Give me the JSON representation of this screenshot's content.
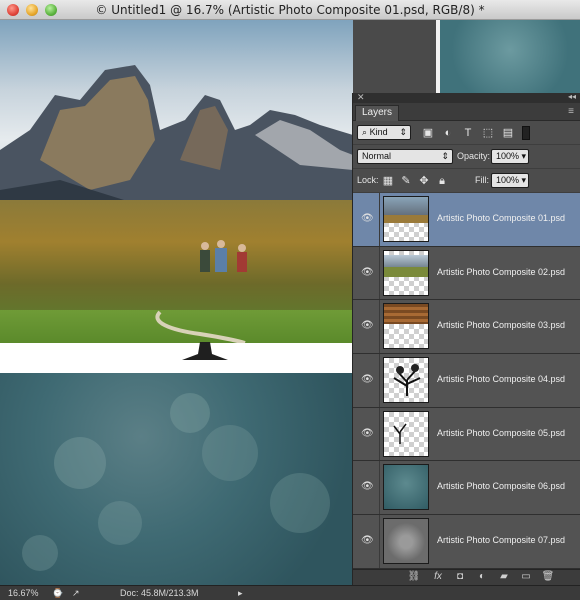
{
  "window": {
    "title": "© Untitled1 @ 16.7% (Artistic Photo Composite 01.psd, RGB/8) *"
  },
  "status": {
    "zoom": "16.67%",
    "doc": "Doc: 45.8M/213.3M"
  },
  "layers_panel": {
    "tab_label": "Layers",
    "filter_label": "Kind",
    "blend_mode": "Normal",
    "opacity_label": "Opacity:",
    "opacity_value": "100%",
    "lock_label": "Lock:",
    "fill_label": "Fill:",
    "fill_value": "100%",
    "layers": [
      {
        "name": "Artistic Photo Composite 01.psd",
        "selected": true,
        "thumb": "mountains"
      },
      {
        "name": "Artistic Photo Composite 02.psd",
        "selected": false,
        "thumb": "landscape"
      },
      {
        "name": "Artistic Photo Composite 03.psd",
        "selected": false,
        "thumb": "wood"
      },
      {
        "name": "Artistic Photo Composite 04.psd",
        "selected": false,
        "thumb": "tree"
      },
      {
        "name": "Artistic Photo Composite 05.psd",
        "selected": false,
        "thumb": "small-tree"
      },
      {
        "name": "Artistic Photo Composite 06.psd",
        "selected": false,
        "thumb": "teal-bokeh"
      },
      {
        "name": "Artistic Photo Composite 07.psd",
        "selected": false,
        "thumb": "gravel"
      }
    ]
  },
  "colors": {
    "selection": "#6f87a9",
    "panel": "#535353"
  }
}
